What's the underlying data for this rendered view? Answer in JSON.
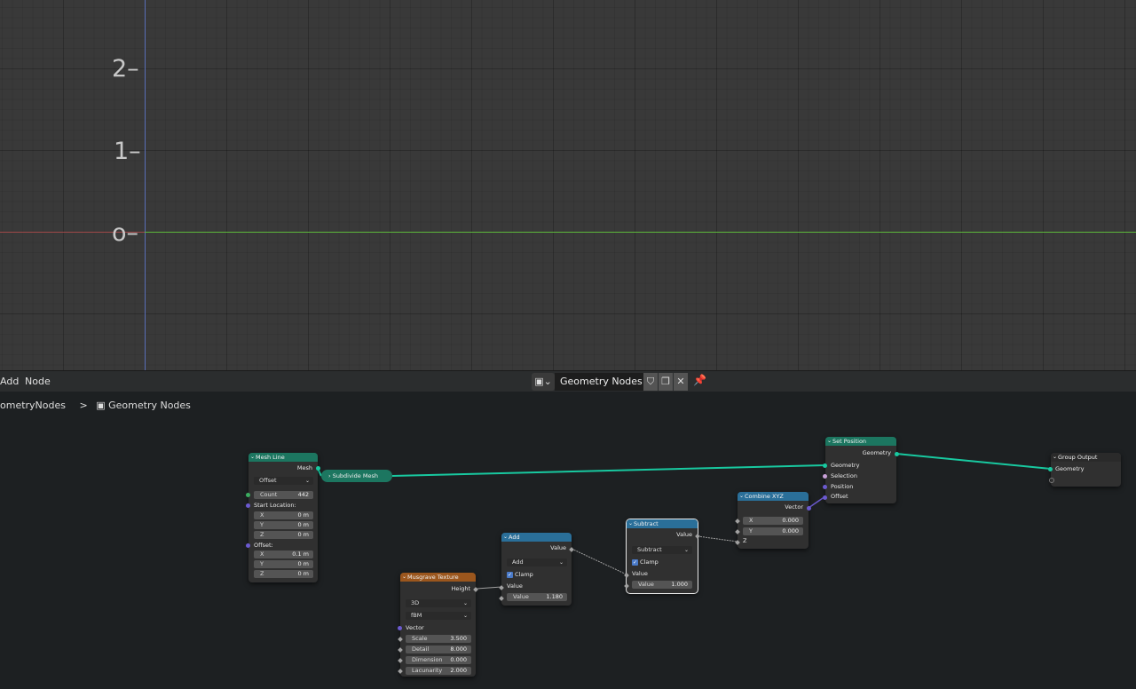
{
  "viewport": {
    "axis_labels": [
      "2–",
      "1–",
      "o–"
    ]
  },
  "header": {
    "menu": [
      "Add",
      "Node"
    ],
    "node_tree_name": "Geometry Nodes",
    "node_tree_icon": "geometry-nodes-icon",
    "buttons": [
      "fake-user-icon",
      "duplicate-icon",
      "close-icon",
      "pin-icon"
    ]
  },
  "breadcrumb": {
    "object": "ometryNodes",
    "separator": ">",
    "tree": "Geometry Nodes"
  },
  "nodes": {
    "mesh_line": {
      "title": "Mesh Line",
      "output": "Mesh",
      "mode": "Offset",
      "count_label": "Count",
      "count_value": "442",
      "start_label": "Start Location:",
      "start": [
        {
          "axis": "X",
          "value": "0 m"
        },
        {
          "axis": "Y",
          "value": "0 m"
        },
        {
          "axis": "Z",
          "value": "0 m"
        }
      ],
      "offset_label": "Offset:",
      "offset": [
        {
          "axis": "X",
          "value": "0.1 m"
        },
        {
          "axis": "Y",
          "value": "0 m"
        },
        {
          "axis": "Z",
          "value": "0 m"
        }
      ]
    },
    "subdivide_mesh": {
      "title": "Subdivide Mesh"
    },
    "musgrave": {
      "title": "Musgrave Texture",
      "output": "Height",
      "dimensions": "3D",
      "type": "fBM",
      "vector_label": "Vector",
      "fields": [
        {
          "label": "Scale",
          "value": "3.500"
        },
        {
          "label": "Detail",
          "value": "8.000"
        },
        {
          "label": "Dimension",
          "value": "0.000"
        },
        {
          "label": "Lacunarity",
          "value": "2.000"
        }
      ]
    },
    "add": {
      "title": "Add",
      "output": "Value",
      "operation": "Add",
      "clamp": "Clamp",
      "input_label": "Value",
      "field_label": "Value",
      "field_value": "1.180"
    },
    "subtract": {
      "title": "Subtract",
      "output": "Value",
      "operation": "Subtract",
      "clamp": "Clamp",
      "input_label": "Value",
      "field_label": "Value",
      "field_value": "1.000"
    },
    "combine_xyz": {
      "title": "Combine XYZ",
      "output": "Vector",
      "fields": [
        {
          "label": "X",
          "value": "0.000"
        },
        {
          "label": "Y",
          "value": "0.000"
        }
      ],
      "z_label": "Z"
    },
    "set_position": {
      "title": "Set Position",
      "output": "Geometry",
      "inputs": [
        "Geometry",
        "Selection",
        "Position",
        "Offset"
      ]
    },
    "group_output": {
      "title": "Group Output",
      "input": "Geometry"
    }
  },
  "colors": {
    "geometry_header": "#1c7660",
    "converter_header": "#2a6f99",
    "texture_header": "#9b561d",
    "geometry_link": "#18c9a0"
  }
}
